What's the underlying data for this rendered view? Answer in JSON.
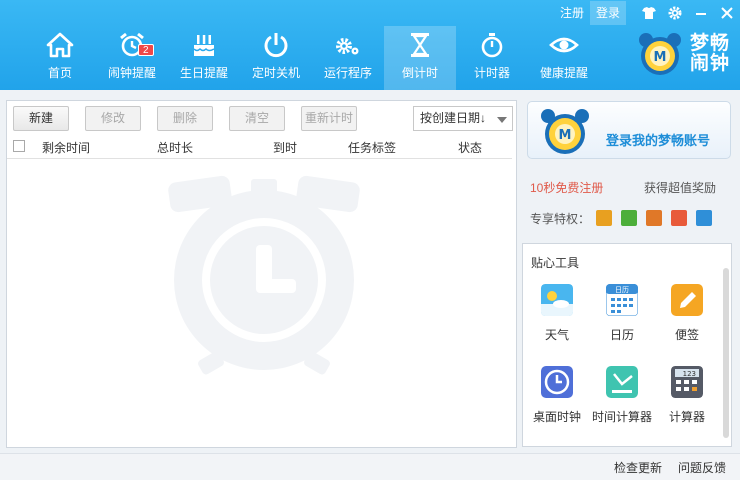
{
  "top_links": {
    "register": "注册",
    "login": "登录"
  },
  "nav": [
    {
      "label": "首页",
      "icon": "home-icon"
    },
    {
      "label": "闹钟提醒",
      "icon": "alarm-clock-icon",
      "badge": "2"
    },
    {
      "label": "生日提醒",
      "icon": "birthday-cake-icon"
    },
    {
      "label": "定时关机",
      "icon": "power-icon"
    },
    {
      "label": "运行程序",
      "icon": "gears-icon"
    },
    {
      "label": "倒计时",
      "icon": "hourglass-icon",
      "active": true
    },
    {
      "label": "计时器",
      "icon": "stopwatch-icon"
    },
    {
      "label": "健康提醒",
      "icon": "eye-icon"
    }
  ],
  "brand": {
    "line1": "梦畅",
    "line2": "闹钟"
  },
  "toolbar": {
    "new": "新建",
    "edit": "修改",
    "delete": "删除",
    "clear": "清空",
    "restart": "重新计时",
    "sort_selected": "按创建日期↓"
  },
  "table": {
    "columns": [
      "剩余时间",
      "总时长",
      "到时",
      "任务标签",
      "状态"
    ],
    "rows": []
  },
  "account": {
    "login_text": "登录我的梦畅账号",
    "register_link": "10秒免费注册",
    "reward": "获得超值奖励",
    "privileges_label": "专享特权："
  },
  "privileges": [
    {
      "icon": "gift-icon",
      "color": "#e8a020"
    },
    {
      "icon": "link-icon",
      "color": "#4cae3a"
    },
    {
      "icon": "film-icon",
      "color": "#e07828"
    },
    {
      "icon": "present-icon",
      "color": "#e85a3a"
    },
    {
      "icon": "home-badge-icon",
      "color": "#2f8fd8"
    }
  ],
  "tools": {
    "title": "贴心工具",
    "items": [
      {
        "label": "天气",
        "icon": "weather-icon"
      },
      {
        "label": "日历",
        "icon": "calendar-icon",
        "icon_text": "日历"
      },
      {
        "label": "便签",
        "icon": "note-pencil-icon"
      },
      {
        "label": "桌面时钟",
        "icon": "desk-clock-icon"
      },
      {
        "label": "时间计算器",
        "icon": "time-calc-icon"
      },
      {
        "label": "计算器",
        "icon": "calculator-icon",
        "icon_text": "123"
      }
    ]
  },
  "status": {
    "check_update": "检查更新",
    "feedback": "问题反馈"
  },
  "colors": {
    "header": "#28a8ee",
    "accent_text": "#1f8ed8",
    "register": "#e05a4a",
    "badge": "#f04848"
  }
}
